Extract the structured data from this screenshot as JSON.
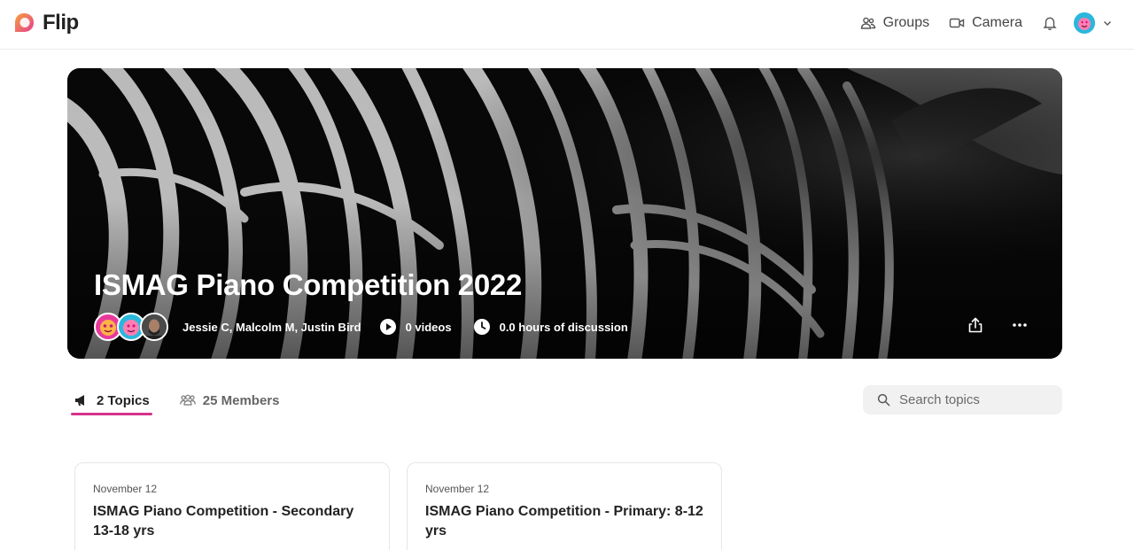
{
  "app": {
    "name": "Flip"
  },
  "nav": {
    "groups_label": "Groups",
    "camera_label": "Camera"
  },
  "banner": {
    "title": "ISMAG Piano Competition 2022",
    "owners": "Jessie C, Malcolm M, Justin Bird",
    "videos": "0 videos",
    "discussion": "0.0 hours of discussion"
  },
  "tabs": [
    {
      "label": "2 Topics",
      "active": true
    },
    {
      "label": "25 Members",
      "active": false
    }
  ],
  "search": {
    "placeholder": "Search topics"
  },
  "topics": [
    {
      "date": "November 12",
      "title": "ISMAG Piano Competition - Secondary 13-18 yrs"
    },
    {
      "date": "November 12",
      "title": "ISMAG Piano Competition - Primary: 8-12 yrs"
    }
  ],
  "colors": {
    "accent": "#d6338c",
    "brand_pink": "#e8399c",
    "brand_blue": "#2bb7dc"
  }
}
